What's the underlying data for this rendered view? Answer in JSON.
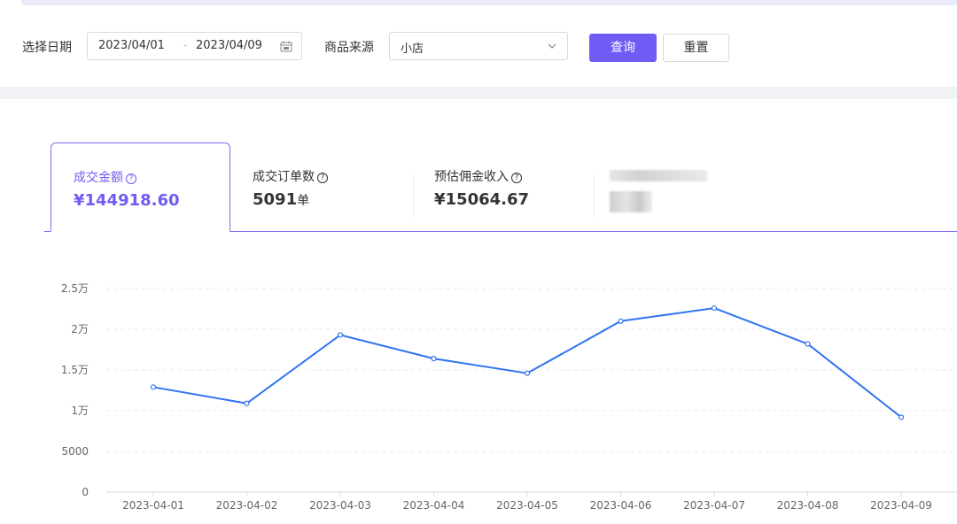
{
  "filters": {
    "date_label": "选择日期",
    "date_start": "2023/04/01",
    "date_sep": "-",
    "date_end": "2023/04/09",
    "source_label": "商品来源",
    "source_value": "小店",
    "query_button": "查询",
    "reset_button": "重置"
  },
  "metrics": [
    {
      "label": "成交金额",
      "value": "¥144918.60",
      "unit": "",
      "active": true
    },
    {
      "label": "成交订单数",
      "value": "5091",
      "unit": "单",
      "active": false
    },
    {
      "label": "预估佣金收入",
      "value": "¥15064.67",
      "unit": "",
      "active": false
    }
  ],
  "colors": {
    "accent": "#6e5cf4",
    "line": "#2f73f0"
  },
  "chart_data": {
    "type": "line",
    "categories": [
      "2023-04-01",
      "2023-04-02",
      "2023-04-03",
      "2023-04-04",
      "2023-04-05",
      "2023-04-06",
      "2023-04-07",
      "2023-04-08",
      "2023-04-09"
    ],
    "series": [
      {
        "values": [
          12900,
          10900,
          19300,
          16400,
          14600,
          21000,
          22600,
          18200,
          9200
        ]
      }
    ],
    "y_ticks": [
      {
        "value": 0,
        "label": "0"
      },
      {
        "value": 5000,
        "label": "5000"
      },
      {
        "value": 10000,
        "label": "1万"
      },
      {
        "value": 15000,
        "label": "1.5万"
      },
      {
        "value": 20000,
        "label": "2万"
      },
      {
        "value": 25000,
        "label": "2.5万"
      }
    ],
    "ylim": [
      0,
      25000
    ],
    "grid": true
  }
}
